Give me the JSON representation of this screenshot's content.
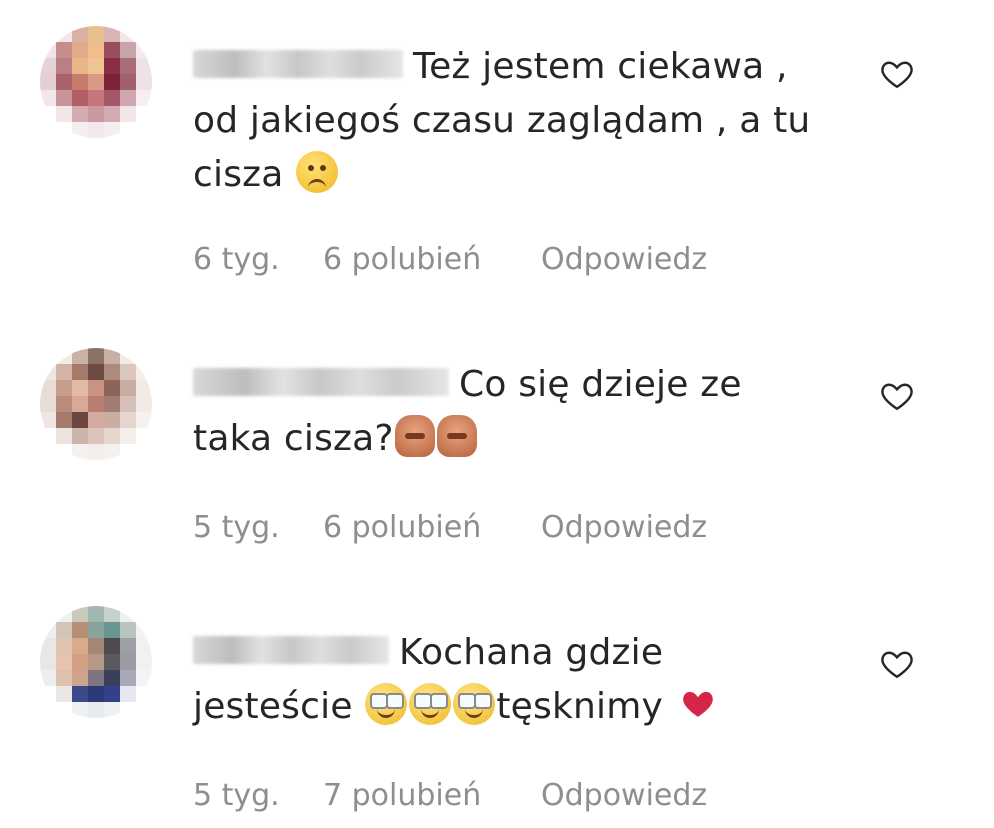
{
  "comments": [
    {
      "text": "Też jestem ciekawa , od jakiegoś czasu zaglądam , a tu cisza",
      "emojis": [
        "slightly-frowning-face"
      ],
      "time": "6 tyg.",
      "likes": "6 polubień",
      "reply": "Odpowiedz",
      "avatar_colors": [
        "#f2dfe4",
        "#d8b8bd",
        "#c99a95",
        "#e0b79d",
        "#a86a6a",
        "#c48a7c",
        "#f0e5e8"
      ]
    },
    {
      "text": "Co się dzieje ze taka cisza?",
      "emojis": [
        "see-no-evil-monkey",
        "see-no-evil-monkey"
      ],
      "time": "5 tyg.",
      "likes": "6 polubień",
      "reply": "Odpowiedz",
      "avatar_colors": [
        "#e8ddd8",
        "#c7a79a",
        "#8e6c62",
        "#d7b3a4",
        "#6f4f49",
        "#b68f82",
        "#f1e8e5"
      ]
    },
    {
      "text_before": "Kochana gdzie jesteście",
      "text_after": "tęsknimy",
      "emojis": [
        "smiling-face-with-glasses",
        "smiling-face-with-glasses",
        "smiling-face-with-glasses"
      ],
      "trailing_emoji": "red-heart",
      "time": "5 tyg.",
      "likes": "7 polubień",
      "reply": "Odpowiedz",
      "avatar_colors": [
        "#e9ecef",
        "#b9c0b8",
        "#7b9994",
        "#d7b7a0",
        "#3d3f46",
        "#2d3a7a",
        "#efeef2"
      ]
    }
  ]
}
